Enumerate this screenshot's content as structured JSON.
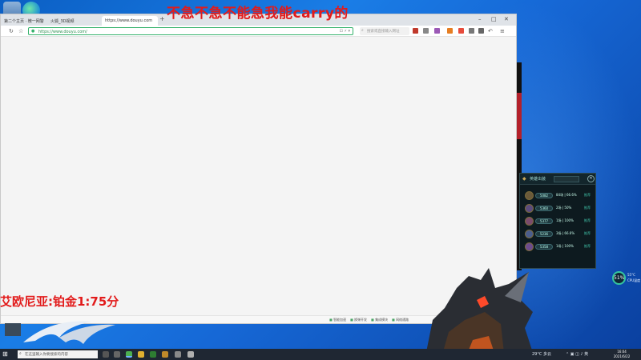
{
  "overlay": {
    "banner_text": "不急不急不能急我能carry的",
    "rank_text": "艾欧尼亚:铂金1:75分"
  },
  "browser": {
    "tabs": [
      {
        "label": "第二个主页 · 微一网警",
        "active": false
      },
      {
        "label": "火狐_3D视频",
        "active": false
      },
      {
        "label": "https://www.douyu.com",
        "active": true
      }
    ],
    "url": "https://www.douyu.com/",
    "search_placeholder": "搜索或直接输入网址",
    "status_items": [
      "智能加速",
      "换弹开发",
      "集成模块",
      "网络通路"
    ]
  },
  "champion_panel": {
    "title": "英雄出装",
    "close_glyph": "✕",
    "rows": [
      {
        "pill": "5082",
        "stat": "84场 | 66.6%",
        "link": "推荐",
        "color": "#6b5a3a"
      },
      {
        "pill": "5360",
        "stat": "2场 | 50%",
        "link": "推荐",
        "color": "#5b4b7c"
      },
      {
        "pill": "5377",
        "stat": "1场 | 100%",
        "link": "推荐",
        "color": "#7a4b6c"
      },
      {
        "pill": "5236",
        "stat": "3场 | 66.6%",
        "link": "推荐",
        "color": "#4b5d8c"
      },
      {
        "pill": "5358",
        "stat": "1场 | 100%",
        "link": "推荐",
        "color": "#6c4b8c"
      }
    ]
  },
  "perf_widget": {
    "value": "51%",
    "line1": "55°C",
    "line2": "CPU温度"
  },
  "taskbar": {
    "search_placeholder": "在这里输入你要搜索的内容",
    "weather": "29°C 多云",
    "time": "16:04",
    "date": "2021/6/22"
  },
  "colors": {
    "overlay_red": "#e21b1b",
    "accent_green": "#35b26b",
    "panel_teal": "#3fc2a8"
  }
}
